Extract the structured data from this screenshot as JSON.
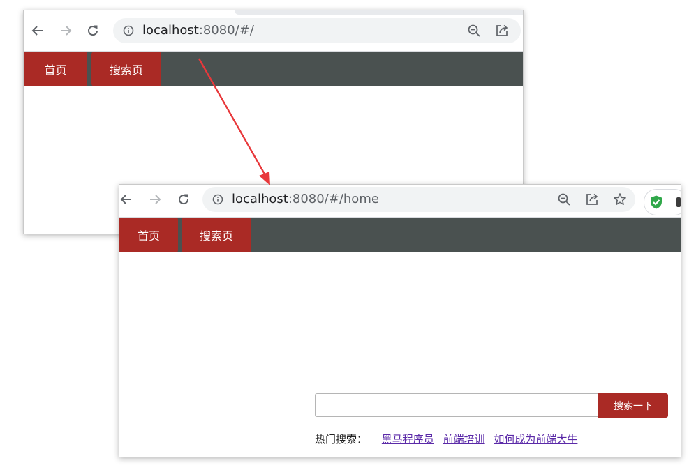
{
  "window1": {
    "address": {
      "host": "localhost",
      "rest": ":8080/#/"
    },
    "nav": {
      "home_label": "首页",
      "search_label": "搜索页"
    }
  },
  "window2": {
    "address": {
      "host": "localhost",
      "rest": ":8080/#/home"
    },
    "nav": {
      "home_label": "首页",
      "search_label": "搜索页"
    },
    "search": {
      "input_value": "",
      "button_label": "搜索一下"
    },
    "hot": {
      "label": "热门搜索：",
      "links": [
        "黑马程序员",
        "前端培训",
        "如何成为前端大牛"
      ]
    }
  },
  "icons": {
    "back": "arrow-left-icon",
    "forward": "arrow-right-icon",
    "reload": "reload-icon",
    "info": "info-icon",
    "zoom_out": "zoom-out-icon",
    "share": "share-icon",
    "bookmark": "star-icon",
    "extension": "shield-check-icon"
  },
  "colors": {
    "brand_red": "#aa2a25",
    "nav_bar": "#4a5150",
    "link_visited": "#5b2aa8",
    "annotation_arrow": "#e8383b"
  }
}
